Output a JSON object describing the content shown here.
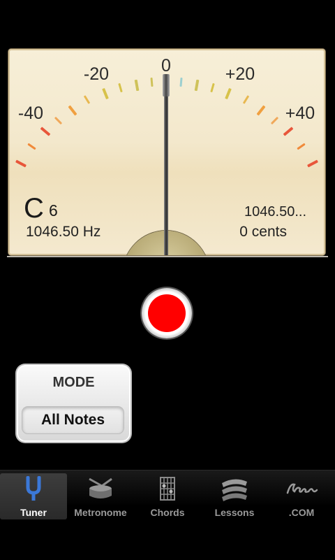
{
  "meter": {
    "scale": {
      "minus40": "-40",
      "minus20": "-20",
      "zero": "0",
      "plus20": "+20",
      "plus40": "+40"
    },
    "note": {
      "letter": "C",
      "octave": "6",
      "frequency": "1046.50 Hz"
    },
    "reading": {
      "frequency": "1046.50...",
      "cents": "0 cents"
    },
    "needle_cents": 0
  },
  "record_button": {
    "color": "#ff0000"
  },
  "mode": {
    "label": "MODE",
    "value": "All Notes"
  },
  "tabs": [
    {
      "label": "Tuner",
      "icon": "tuning-fork-icon",
      "active": true
    },
    {
      "label": "Metronome",
      "icon": "drum-icon",
      "active": false
    },
    {
      "label": "Chords",
      "icon": "chord-grid-icon",
      "active": false
    },
    {
      "label": "Lessons",
      "icon": "lessons-icon",
      "active": false
    },
    {
      "label": ".COM",
      "icon": "gibson-logo-icon",
      "active": false
    }
  ],
  "colors": {
    "accent_blue": "#3b78d8",
    "tick_red": "#e8563a",
    "tick_orange": "#f08a3a",
    "tick_yellow": "#d7c24a"
  }
}
